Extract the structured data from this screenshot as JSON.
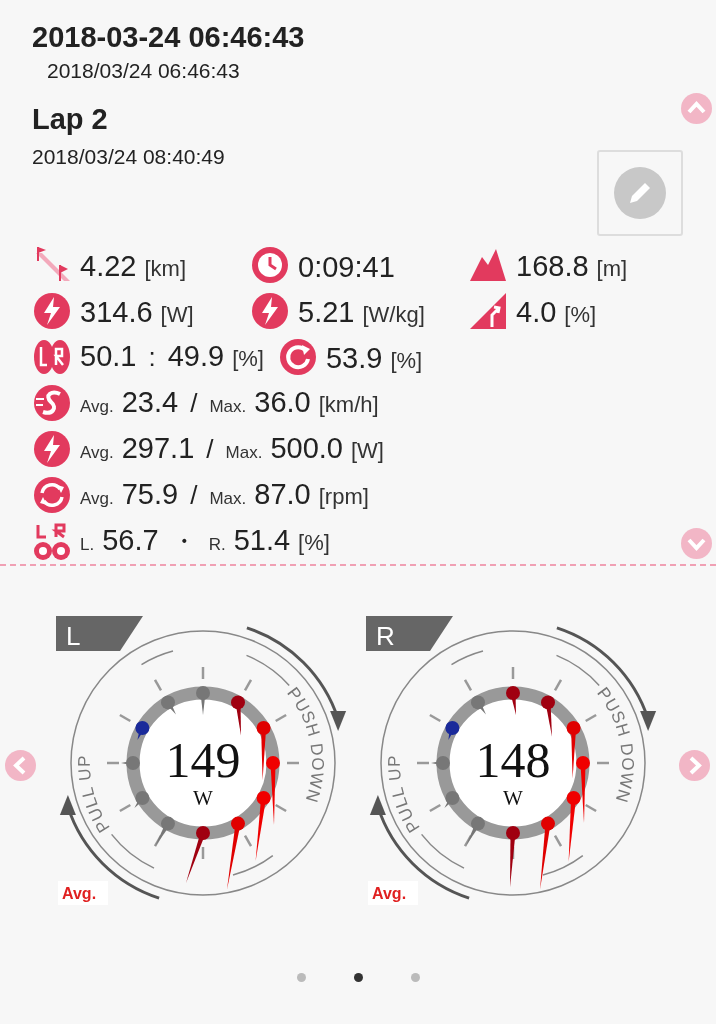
{
  "header": {
    "title": "2018-03-24 06:46:43",
    "subtitle": "2018/03/24 06:46:43"
  },
  "lap": {
    "title": "Lap 2",
    "time": "2018/03/24 08:40:49"
  },
  "metrics": [
    {
      "items": [
        {
          "kind": "distance",
          "parts": [
            {
              "kind": "value",
              "text": "4.22"
            },
            {
              "kind": "unit",
              "text": "[km]"
            }
          ]
        },
        {
          "kind": "time",
          "parts": [
            {
              "kind": "value",
              "text": "0:09:41"
            }
          ]
        },
        {
          "kind": "elevation",
          "parts": [
            {
              "kind": "value",
              "text": "168.8"
            },
            {
              "kind": "unit",
              "text": "[m]"
            }
          ]
        }
      ]
    },
    {
      "items": [
        {
          "kind": "np",
          "parts": [
            {
              "kind": "value",
              "text": "314.6"
            },
            {
              "kind": "unit",
              "text": "[W]"
            }
          ]
        },
        {
          "kind": "pwr",
          "parts": [
            {
              "kind": "value",
              "text": "5.21"
            },
            {
              "kind": "unit",
              "text": "[W/kg]"
            }
          ]
        },
        {
          "kind": "gradient",
          "parts": [
            {
              "kind": "value",
              "text": "4.0"
            },
            {
              "kind": "unit",
              "text": "[%]"
            }
          ]
        }
      ]
    },
    {
      "items": [
        {
          "kind": "balance",
          "parts": [
            {
              "kind": "value",
              "text": "50.1"
            },
            {
              "kind": "sep",
              "text": ":"
            },
            {
              "kind": "value",
              "text": "49.9"
            },
            {
              "kind": "unit",
              "text": "[%]"
            }
          ]
        },
        {
          "kind": "efficiency",
          "parts": [
            {
              "kind": "value",
              "text": "53.9"
            },
            {
              "kind": "unit",
              "text": "[%]"
            }
          ]
        }
      ]
    },
    {
      "items": [
        {
          "kind": "speed",
          "parts": [
            {
              "kind": "label",
              "text": "Avg."
            },
            {
              "kind": "value",
              "text": "23.4"
            },
            {
              "kind": "sep",
              "text": "/"
            },
            {
              "kind": "label",
              "text": "Max."
            },
            {
              "kind": "value",
              "text": "36.0"
            },
            {
              "kind": "unit",
              "text": "[km/h]"
            }
          ]
        }
      ]
    },
    {
      "items": [
        {
          "kind": "power",
          "parts": [
            {
              "kind": "label",
              "text": "Avg."
            },
            {
              "kind": "value",
              "text": "297.1"
            },
            {
              "kind": "sep",
              "text": "/"
            },
            {
              "kind": "label",
              "text": "Max."
            },
            {
              "kind": "value",
              "text": "500.0"
            },
            {
              "kind": "unit",
              "text": "[W]"
            }
          ]
        }
      ]
    },
    {
      "items": [
        {
          "kind": "cadence",
          "parts": [
            {
              "kind": "label",
              "text": "Avg."
            },
            {
              "kind": "value",
              "text": "75.9"
            },
            {
              "kind": "sep",
              "text": "/"
            },
            {
              "kind": "label",
              "text": "Max."
            },
            {
              "kind": "value",
              "text": "87.0"
            },
            {
              "kind": "unit",
              "text": "[rpm]"
            }
          ]
        }
      ]
    },
    {
      "items": [
        {
          "kind": "smoothness",
          "parts": [
            {
              "kind": "label",
              "text": "L."
            },
            {
              "kind": "value",
              "text": "56.7"
            },
            {
              "kind": "sep",
              "text": "・"
            },
            {
              "kind": "label",
              "text": "R."
            },
            {
              "kind": "value",
              "text": "51.4"
            },
            {
              "kind": "unit",
              "text": "[%]"
            }
          ]
        }
      ]
    }
  ],
  "dials": [
    {
      "side": "L",
      "value": "149",
      "unit": "W",
      "pull_label": "PULL UP",
      "push_label": "PUSH DOWN",
      "avg_label": "Avg."
    },
    {
      "side": "R",
      "value": "148",
      "unit": "W",
      "pull_label": "PULL UP",
      "push_label": "PUSH DOWN",
      "avg_label": "Avg."
    }
  ],
  "pager": [
    {
      "selected": false
    },
    {
      "selected": true
    },
    {
      "selected": false
    }
  ]
}
